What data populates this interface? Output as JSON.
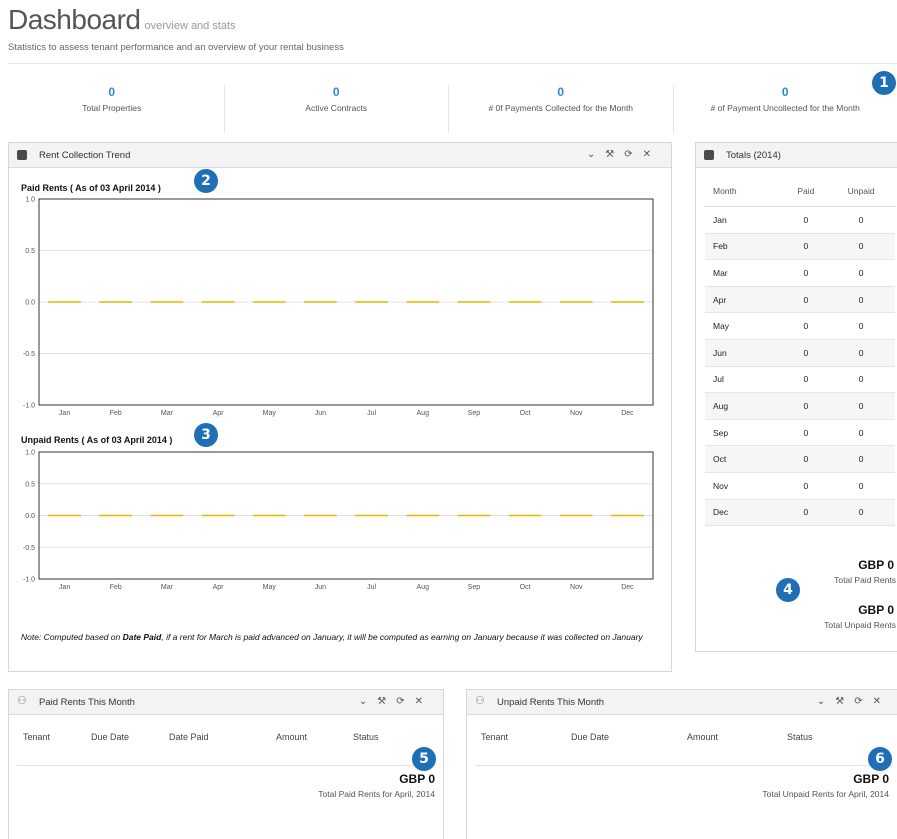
{
  "page": {
    "title": "Dashboard",
    "subtitle": "overview and stats",
    "description": "Statistics to assess tenant performance and an overview of your rental business"
  },
  "stats": [
    {
      "value": "0",
      "label": "Total Properties"
    },
    {
      "value": "0",
      "label": "Active Contracts"
    },
    {
      "value": "0",
      "label": "# 0f Payments Collected for the Month"
    },
    {
      "value": "0",
      "label": "# of Payment Uncollected for the Month"
    }
  ],
  "badges": [
    "1",
    "2",
    "3",
    "4",
    "5",
    "6"
  ],
  "trend_widget": {
    "title": "Rent Collection Trend",
    "icon": "expand-icon",
    "tools": [
      "chevron-down-icon",
      "wrench-icon",
      "refresh-icon",
      "close-icon"
    ],
    "note_pre": "Note: Computed based on ",
    "note_bold": "Date Paid",
    "note_post": ", if a rent for March is paid advanced on January, it will be computed as earning on January because it was collected on January"
  },
  "chart_data": [
    {
      "type": "line",
      "title": "Paid Rents ( As of 03 April 2014 )",
      "categories": [
        "Jan",
        "Feb",
        "Mar",
        "Apr",
        "May",
        "Jun",
        "Jul",
        "Aug",
        "Sep",
        "Oct",
        "Nov",
        "Dec"
      ],
      "values": [
        0,
        0,
        0,
        0,
        0,
        0,
        0,
        0,
        0,
        0,
        0,
        0
      ],
      "ylim": [
        -1.0,
        1.0
      ],
      "yticks": [
        "1.0",
        "0.5",
        "0.0",
        "-0.5",
        "-1.0"
      ],
      "color": "#f0b400",
      "grid": true
    },
    {
      "type": "line",
      "title": "Unpaid Rents ( As of 03 April 2014 )",
      "categories": [
        "Jan",
        "Feb",
        "Mar",
        "Apr",
        "May",
        "Jun",
        "Jul",
        "Aug",
        "Sep",
        "Oct",
        "Nov",
        "Dec"
      ],
      "values": [
        0,
        0,
        0,
        0,
        0,
        0,
        0,
        0,
        0,
        0,
        0,
        0
      ],
      "ylim": [
        -1.0,
        1.0
      ],
      "yticks": [
        "1.0",
        "0.5",
        "0.0",
        "-0.5",
        "-1.0"
      ],
      "color": "#f0b400",
      "grid": true
    }
  ],
  "totals_widget": {
    "title": "Totals (2014)",
    "headers": [
      "Month",
      "Paid",
      "Unpaid"
    ],
    "rows": [
      [
        "Jan",
        "0",
        "0"
      ],
      [
        "Feb",
        "0",
        "0"
      ],
      [
        "Mar",
        "0",
        "0"
      ],
      [
        "Apr",
        "0",
        "0"
      ],
      [
        "May",
        "0",
        "0"
      ],
      [
        "Jun",
        "0",
        "0"
      ],
      [
        "Jul",
        "0",
        "0"
      ],
      [
        "Aug",
        "0",
        "0"
      ],
      [
        "Sep",
        "0",
        "0"
      ],
      [
        "Oct",
        "0",
        "0"
      ],
      [
        "Nov",
        "0",
        "0"
      ],
      [
        "Dec",
        "0",
        "0"
      ]
    ],
    "paid_value": "GBP 0",
    "paid_label": "Total Paid Rents",
    "unpaid_value": "GBP 0",
    "unpaid_label": "Total Unpaid Rents"
  },
  "paid_month_widget": {
    "title": "Paid Rents This Month",
    "headers": [
      "Tenant",
      "Due Date",
      "Date Paid",
      "Amount",
      "Status"
    ],
    "total_value": "GBP 0",
    "total_label": "Total Paid Rents for April, 2014"
  },
  "unpaid_month_widget": {
    "title": "Unpaid Rents This Month",
    "headers": [
      "Tenant",
      "Due Date",
      "Amount",
      "Status"
    ],
    "total_value": "GBP 0",
    "total_label": "Total Unpaid Rents for April, 2014"
  }
}
